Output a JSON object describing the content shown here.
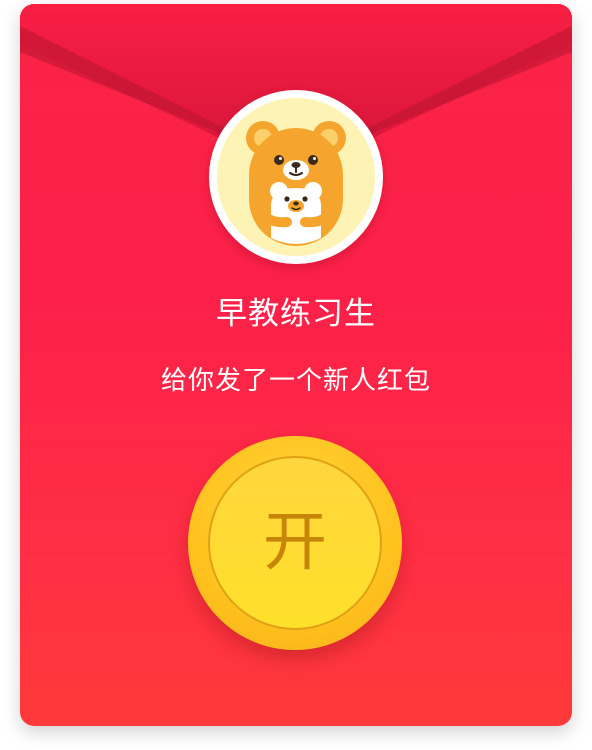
{
  "envelope": {
    "sender_name": "早教练习生",
    "message": "给你发了一个新人红包",
    "open_button_label": "开"
  },
  "avatar": {
    "icon": "bear-mascot-icon"
  },
  "colors": {
    "envelope_red": "#fc2049",
    "flap_dark": "#d8163a",
    "coin_gold": "#ffd43a",
    "coin_text": "#c7850a",
    "avatar_bg": "#fdf3b4"
  }
}
